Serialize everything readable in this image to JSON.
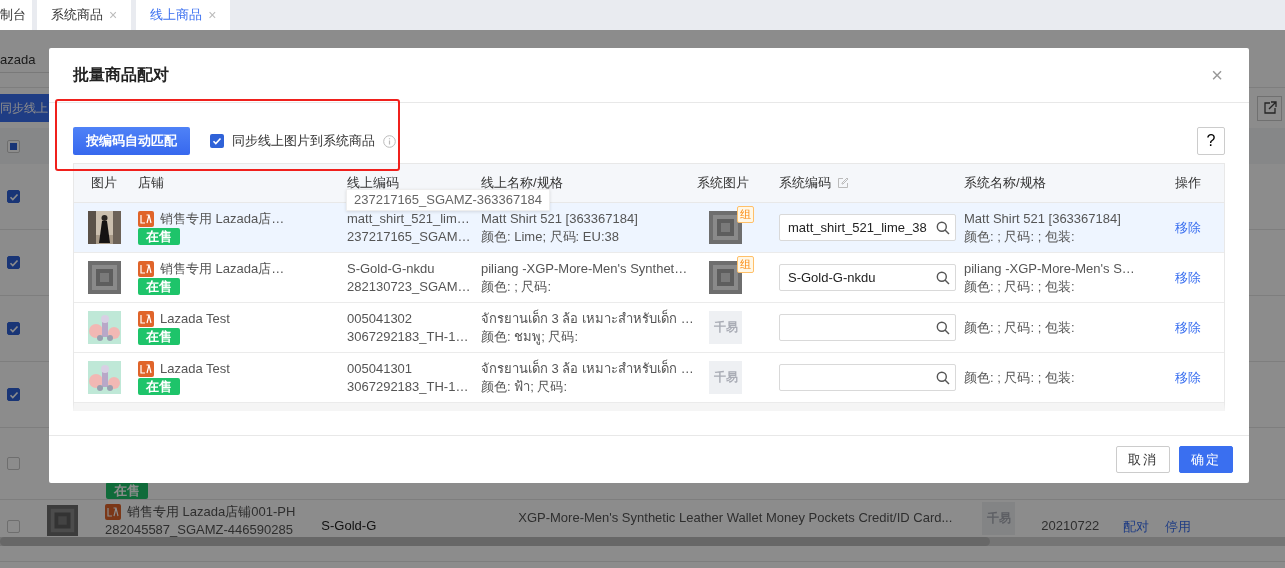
{
  "tabs": [
    {
      "label": "制台",
      "selected": false
    },
    {
      "label": "系统商品",
      "selected": false,
      "close": "×"
    },
    {
      "label": "线上商品",
      "selected": true,
      "close": "×"
    }
  ],
  "background": {
    "filter_value": "azada",
    "sync_button": "同步线上",
    "header_checkbox": {
      "indeterminate": true
    },
    "rows": [
      {
        "checked": true
      },
      {
        "checked": true
      },
      {
        "checked": true
      },
      {
        "checked": true
      },
      {
        "checked": false,
        "status": "在售"
      },
      {
        "checked": false,
        "image": {
          "kind": "frame"
        },
        "shop": "销售专用 Lazada店铺001-PH",
        "online_id": "282045587_SGAMZ-446590285",
        "sys_code": "S-Gold-G",
        "name": "XGP-More-Men's Synthetic Leather Wallet Money Pockets Credit/ID Card...",
        "sys_image": "千易",
        "date": "20210722",
        "actions": [
          "配对",
          "停用"
        ]
      }
    ]
  },
  "dialog": {
    "title": "批量商品配对",
    "close": "×",
    "auto_match_button": "按编码自动匹配",
    "sync_images": {
      "label": "同步线上图片到系统商品",
      "checked": true
    },
    "help_button": "?",
    "columns": [
      "图片",
      "店铺",
      "线上编码",
      "线上名称/规格",
      "系统图片",
      "系统编码",
      "系统名称/规格",
      "操作"
    ],
    "tooltip": "237217165_SGAMZ-363367184",
    "rows": [
      {
        "highlighted": true,
        "image": {
          "kind": "figure"
        },
        "shop": "销售专用 Lazada店…",
        "status": "在售",
        "online_code": "matt_shirt_521_lim…",
        "online_id": "237217165_SGAM…",
        "name": "Matt Shirt 521 [363367184]",
        "spec": "颜色: Lime; 尺码: EU:38",
        "sys_image": {
          "kind": "frame",
          "badge": "组"
        },
        "sys_code": "matt_shirt_521_lime_38",
        "sys_name": "Matt Shirt 521 [363367184]",
        "sys_spec": "颜色: ; 尺码: ; 包装:",
        "action": "移除"
      },
      {
        "highlighted": false,
        "image": {
          "kind": "frame"
        },
        "shop": "销售专用 Lazada店…",
        "status": "在售",
        "online_code": "S-Gold-G-nkdu",
        "online_id": "282130723_SGAM…",
        "name": "piliang -XGP-More-Men's Synthet…",
        "spec": "颜色: ; 尺码:",
        "sys_image": {
          "kind": "frame",
          "badge": "组"
        },
        "sys_code": "S-Gold-G-nkdu",
        "sys_name": "piliang -XGP-More-Men's S…",
        "sys_spec": "颜色: ; 尺码: ; 包装:",
        "action": "移除"
      },
      {
        "highlighted": false,
        "image": {
          "kind": "toy"
        },
        "shop": "Lazada Test",
        "status": "在售",
        "online_code": "005041302",
        "online_id": "3067292183_TH-1…",
        "name": "จักรยานเด็ก 3 ล้อ เหมาะสำหรับเด็ก …",
        "spec": "颜色: ชมพู; 尺码:",
        "sys_image": {
          "kind": "placeholder",
          "text": "千易"
        },
        "sys_spec": "颜色: ; 尺码: ; 包装:",
        "action": "移除"
      },
      {
        "highlighted": false,
        "image": {
          "kind": "toy"
        },
        "shop": "Lazada Test",
        "status": "在售",
        "online_code": "005041301",
        "online_id": "3067292183_TH-1…",
        "name": "จักรยานเด็ก 3 ล้อ เหมาะสำหรับเด็ก …",
        "spec": "颜色: ฟ้า; 尺码:",
        "sys_image": {
          "kind": "placeholder",
          "text": "千易"
        },
        "sys_spec": "颜色: ; 尺码: ; 包装:",
        "action": "移除"
      }
    ],
    "footer_buttons": [
      {
        "label": "取消",
        "kind": "secondary"
      },
      {
        "label": "确定",
        "kind": "primary"
      }
    ]
  }
}
